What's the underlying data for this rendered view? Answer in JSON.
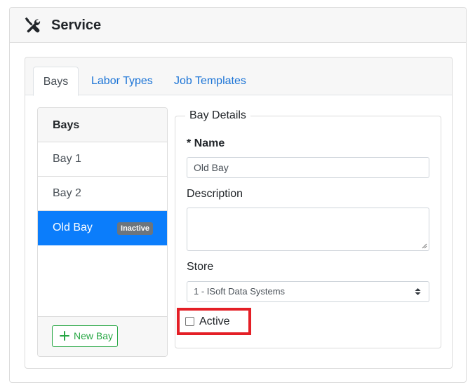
{
  "header": {
    "title": "Service",
    "icon": "tools-icon"
  },
  "tabs": [
    {
      "label": "Bays",
      "active": true
    },
    {
      "label": "Labor Types",
      "active": false
    },
    {
      "label": "Job Templates",
      "active": false
    }
  ],
  "bays_list": {
    "header": "Bays",
    "items": [
      {
        "label": "Bay 1",
        "active": false,
        "badge": ""
      },
      {
        "label": "Bay 2",
        "active": false,
        "badge": ""
      },
      {
        "label": "Old Bay",
        "active": true,
        "badge": "Inactive"
      }
    ],
    "new_button_label": "New Bay"
  },
  "details": {
    "legend": "Bay Details",
    "name_label": "* Name",
    "name_value": "Old Bay",
    "description_label": "Description",
    "description_value": "",
    "store_label": "Store",
    "store_value": "1 - ISoft Data Systems",
    "active_label": "Active",
    "active_checked": false
  },
  "colors": {
    "link": "#1a73d6",
    "active_item": "#0b7dfb",
    "success": "#28a745",
    "badge": "#6c757d",
    "highlight": "#e41f26"
  }
}
